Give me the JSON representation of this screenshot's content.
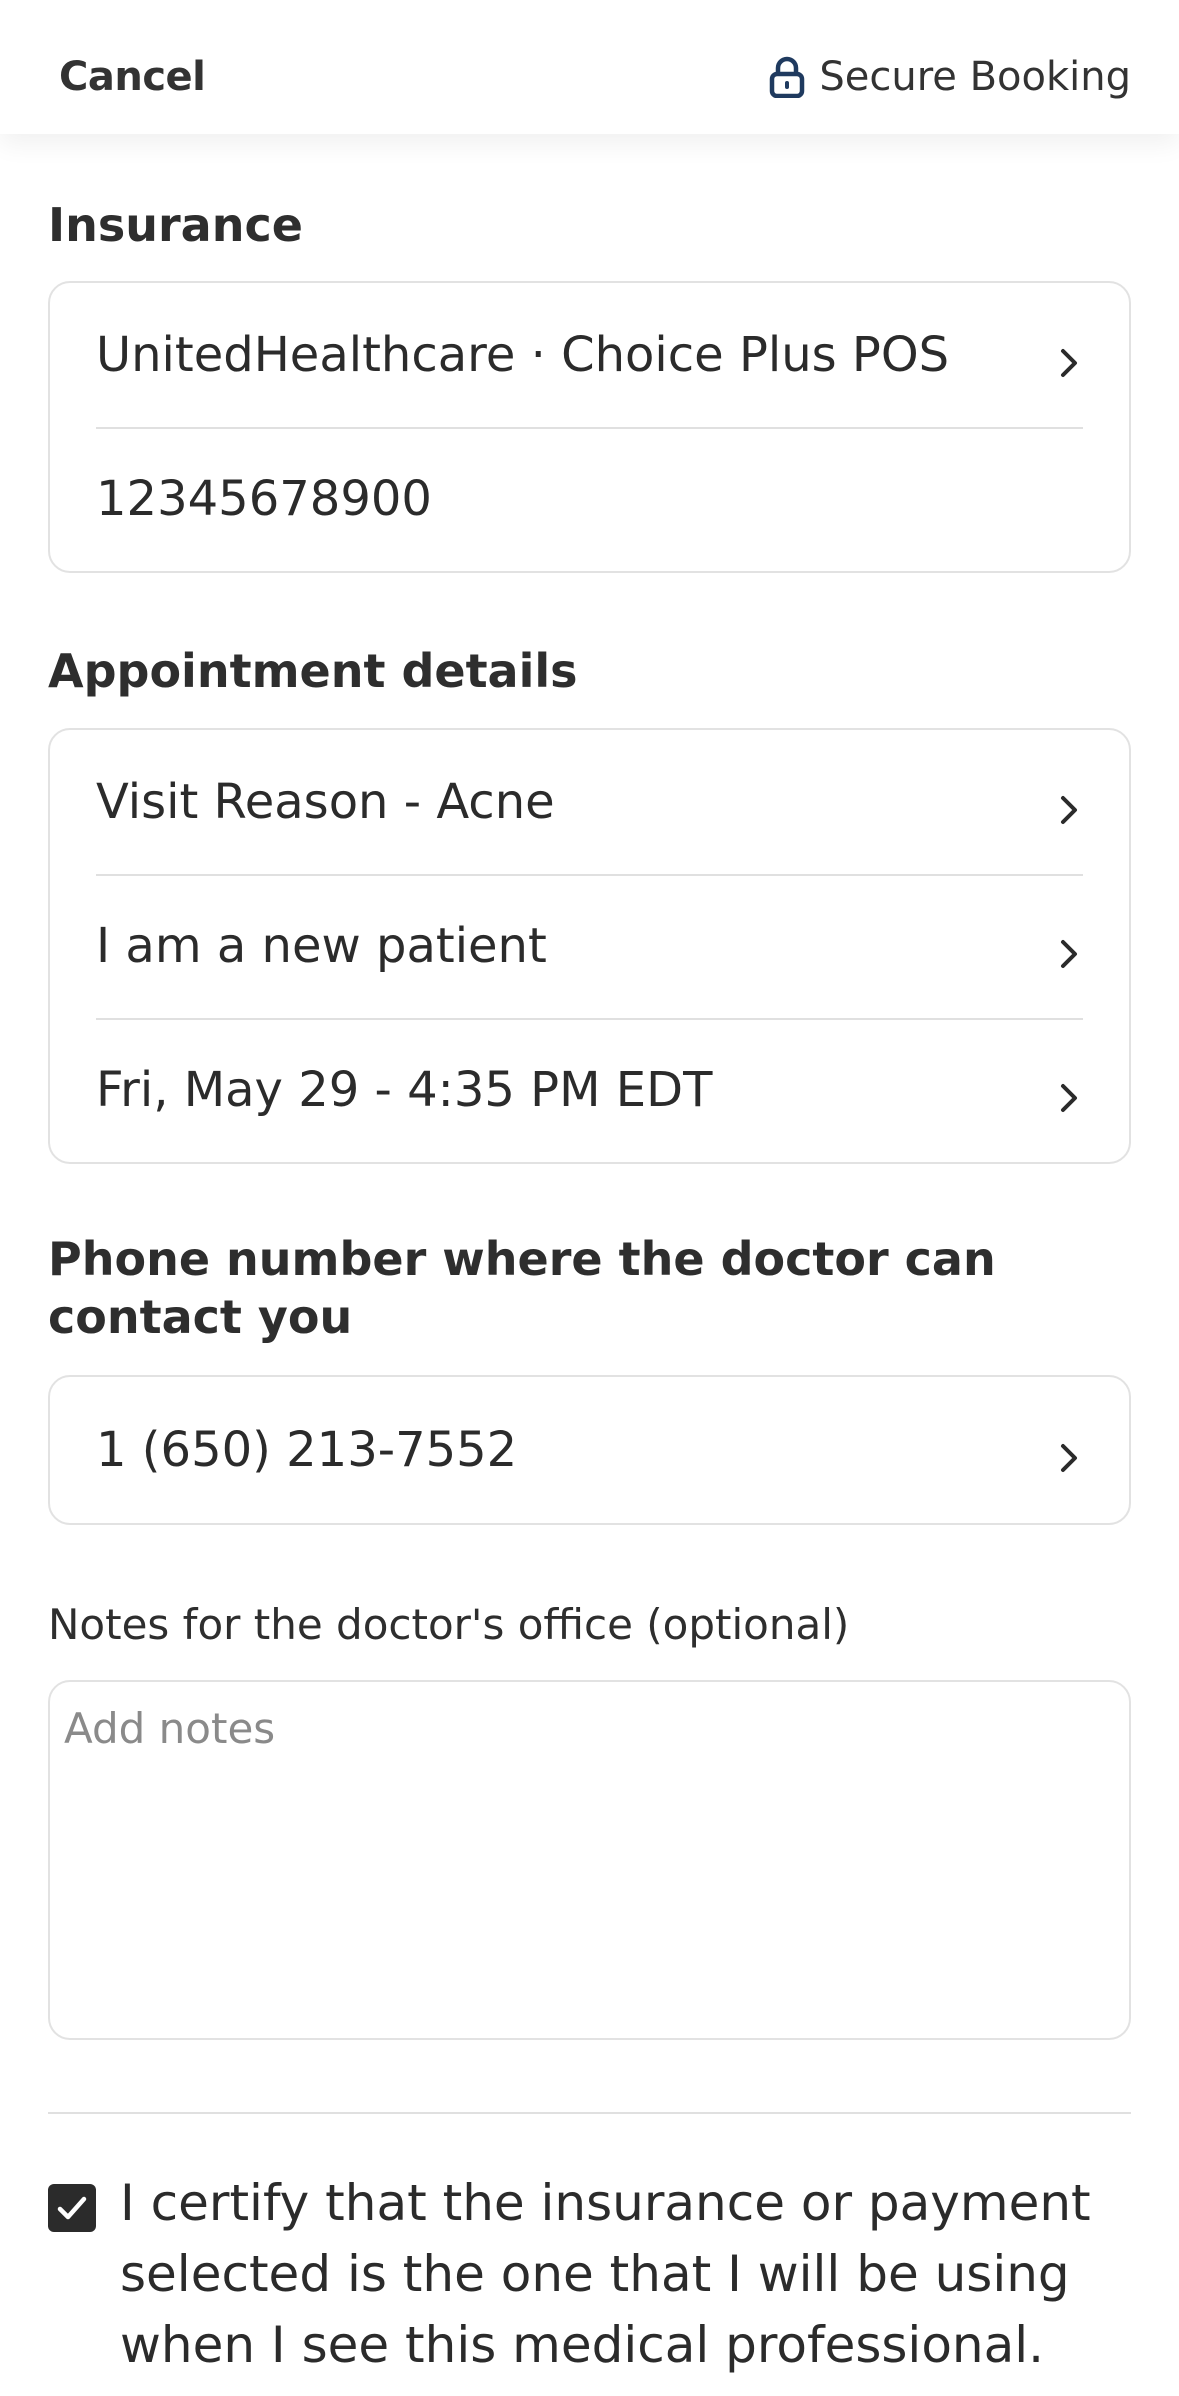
{
  "header": {
    "cancel_label": "Cancel",
    "secure_label": "Secure Booking",
    "icon": "lock-icon"
  },
  "insurance": {
    "title": "Insurance",
    "plan": "UnitedHealthcare · Choice Plus POS",
    "member_id": "12345678900"
  },
  "appointment": {
    "title": "Appointment details",
    "visit_reason": "Visit Reason - Acne",
    "patient_status": "I am a new patient",
    "datetime": "Fri, May 29 - 4:35 PM EDT"
  },
  "phone": {
    "title": "Phone number where the doctor can contact you",
    "number": "1 (650) 213-7552"
  },
  "notes": {
    "label": "Notes for the doctor's office (optional)",
    "placeholder": "Add notes",
    "value": ""
  },
  "certify": {
    "checked": true,
    "text": "I certify that the insurance or payment selected is the one that I will be using when I see this medical professional."
  },
  "colors": {
    "text": "#2b2b2b",
    "border": "#e2e2e2",
    "lock": "#1f3a5f"
  }
}
